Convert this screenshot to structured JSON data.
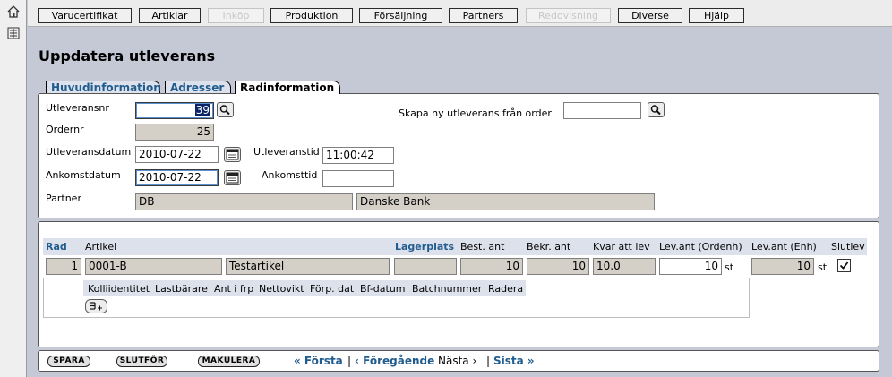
{
  "sidebar": {
    "home_icon": "house-icon",
    "menu_icon": "list-menu-icon"
  },
  "nav": {
    "items": [
      {
        "label": "Varucertifikat",
        "enabled": true
      },
      {
        "label": "Artiklar",
        "enabled": true
      },
      {
        "label": "Inköp",
        "enabled": false
      },
      {
        "label": "Produktion",
        "enabled": true
      },
      {
        "label": "Försäljning",
        "enabled": true
      },
      {
        "label": "Partners",
        "enabled": true
      },
      {
        "label": "Redovisning",
        "enabled": false
      },
      {
        "label": "Diverse",
        "enabled": true
      },
      {
        "label": "Hjälp",
        "enabled": true
      }
    ]
  },
  "page": {
    "title": "Uppdatera utleverans"
  },
  "tabs": [
    {
      "label": "Huvudinformation",
      "active": false
    },
    {
      "label": "Adresser",
      "active": false
    },
    {
      "label": "Radinformation",
      "active": true
    }
  ],
  "form": {
    "utleveransnr_label": "Utleveransnr",
    "utleveransnr_value": "39",
    "skapa_label": "Skapa ny utleverans från order",
    "skapa_value": "",
    "ordernr_label": "Ordernr",
    "ordernr_value": "25",
    "utleveransdatum_label": "Utleveransdatum",
    "utleveransdatum_value": "2010-07-22",
    "utleveranstid_label": "Utleveranstid",
    "utleveranstid_value": "11:00:42",
    "ankomstdatum_label": "Ankomstdatum",
    "ankomstdatum_value": "2010-07-22",
    "ankomsttid_label": "Ankomsttid",
    "ankomsttid_value": "",
    "partner_label": "Partner",
    "partner_code": "DB",
    "partner_name": "Danske Bank"
  },
  "rows_table": {
    "headers": {
      "rad": "Rad",
      "artikel": "Artikel",
      "lagerplats": "Lagerplats",
      "best_ant": "Best. ant",
      "bekr_ant": "Bekr. ant",
      "kvar_att_lev": "Kvar att lev",
      "lev_ant_ordenh": "Lev.ant (Ordenh)",
      "lev_ant_enh": "Lev.ant (Enh)",
      "slutlev": "Slutlev"
    },
    "row": {
      "rad": "1",
      "artikel_code": "0001-B",
      "artikel_name": "Testartikel",
      "lagerplats": "",
      "best_ant": "10",
      "bekr_ant": "10",
      "kvar_att_lev": "10.0",
      "lev_ant_ordenh": "10",
      "lev_ant_ordenh_unit": "st",
      "lev_ant_enh": "10",
      "lev_ant_enh_unit": "st",
      "slutlev_checked": true
    },
    "sub_headers": [
      "Kolliidentitet",
      "Lastbärare",
      "Ant i frp",
      "Nettovikt",
      "Förp. dat",
      "Bf-datum",
      "Batchnummer",
      "Radera"
    ]
  },
  "footer": {
    "spara": "SPARA",
    "slutfor": "SLUTFÖR",
    "makulera": "MAKULERA",
    "forsta": "« Första",
    "sep1": "|",
    "foregaende": "‹ Föregående",
    "nasta": "Nästa ›",
    "sep2": "|",
    "sista": "Sista »"
  },
  "colors": {
    "background": "#c5c9d6",
    "link": "#215c8f",
    "readonly_field": "#d4d0c8",
    "table_header": "#dde1eb"
  }
}
